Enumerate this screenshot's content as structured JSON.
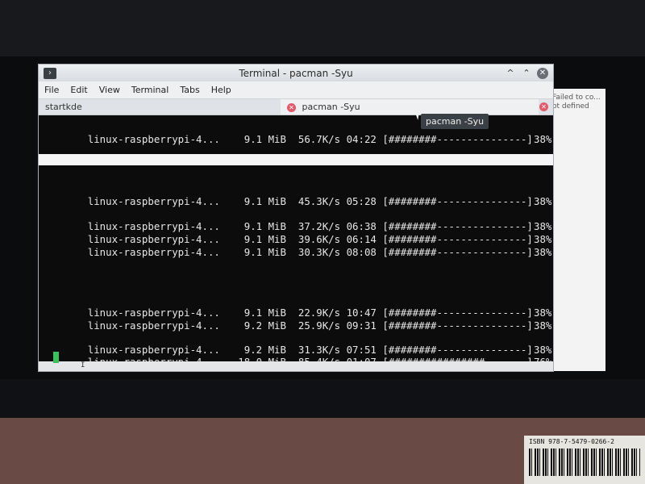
{
  "window": {
    "title": "Terminal - pacman -Syu",
    "controls": [
      "^",
      "⌃",
      "✕"
    ]
  },
  "menu": [
    "File",
    "Edit",
    "View",
    "Terminal",
    "Tabs",
    "Help"
  ],
  "tabs": [
    {
      "label": "startkde"
    },
    {
      "label": "pacman -Syu"
    }
  ],
  "tooltip": "pacman -Syu",
  "background_window_text": "Failed to co...\not defined",
  "downloads": [
    {
      "name": "linux-raspberrypi-4...",
      "size": "9.1 MiB",
      "rate": "56.7K/s",
      "eta": "04:22",
      "bar": "[########---------------]",
      "pct": "38%",
      "progress": 0.38
    },
    {
      "name": "linux-raspberrypi-4...",
      "size": "9.1 MiB",
      "rate": "45.3K/s",
      "eta": "05:28",
      "bar": "[########---------------]",
      "pct": "38%",
      "progress": 0.38
    },
    {
      "name": "linux-raspberrypi-4...",
      "size": "9.1 MiB",
      "rate": "37.2K/s",
      "eta": "06:38",
      "bar": "[########---------------]",
      "pct": "38%",
      "progress": 0.38
    },
    {
      "name": "linux-raspberrypi-4...",
      "size": "9.1 MiB",
      "rate": "39.6K/s",
      "eta": "06:14",
      "bar": "[########---------------]",
      "pct": "38%",
      "progress": 0.38
    },
    {
      "name": "linux-raspberrypi-4...",
      "size": "9.1 MiB",
      "rate": "30.3K/s",
      "eta": "08:08",
      "bar": "[########---------------]",
      "pct": "38%",
      "progress": 0.38
    },
    {
      "name": "linux-raspberrypi-4...",
      "size": "9.1 MiB",
      "rate": "22.9K/s",
      "eta": "10:47",
      "bar": "[########---------------]",
      "pct": "38%",
      "progress": 0.38
    },
    {
      "name": "linux-raspberrypi-4...",
      "size": "9.2 MiB",
      "rate": "25.9K/s",
      "eta": "09:31",
      "bar": "[########---------------]",
      "pct": "38%",
      "progress": 0.38
    },
    {
      "name": "linux-raspberrypi-4...",
      "size": "9.2 MiB",
      "rate": "31.3K/s",
      "eta": "07:51",
      "bar": "[########---------------]",
      "pct": "38%",
      "progress": 0.38
    },
    {
      "name": "linux-raspberrypi-4...",
      "size": "18.0 MiB",
      "rate": "85.4K/s",
      "eta": "01:07",
      "bar": "[################-------]",
      "pct": "76%",
      "progress": 0.76
    }
  ],
  "sticker": {
    "isbn": "ISBN 978-7-5479-0266-2"
  },
  "colors": {
    "terminal_bg": "#0c0c0c",
    "terminal_fg": "#e6e6e6",
    "cursor": "#39c15a",
    "tab_close": "#e25a6c"
  }
}
